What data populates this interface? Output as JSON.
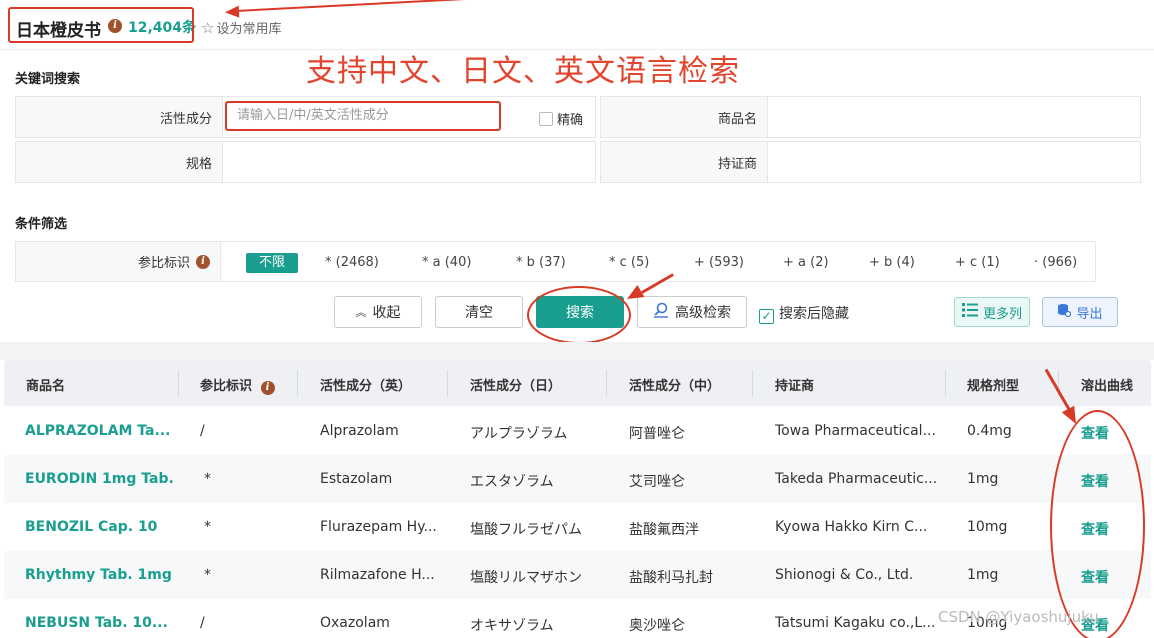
{
  "header": {
    "title": "日本橙皮书",
    "count": "12,404条",
    "favorite_label": "设为常用库"
  },
  "annotation": {
    "text": "支持中文、日文、英文语言检索"
  },
  "keyword_search": {
    "section_title": "关键词搜索",
    "active_ingredient_label": "活性成分",
    "active_ingredient_placeholder": "请输入日/中/英文活性成分",
    "exact_label": "精确",
    "product_name_label": "商品名",
    "spec_label": "规格",
    "holder_label": "持证商"
  },
  "filter": {
    "section_title": "条件筛选",
    "label": "参比标识",
    "options": [
      "不限",
      "* (2468)",
      "* a (40)",
      "* b (37)",
      "* c (5)",
      "+ (593)",
      "+ a (2)",
      "+ b (4)",
      "+ c (1)",
      "· (966)"
    ]
  },
  "actions": {
    "collapse": "收起",
    "clear": "清空",
    "search": "搜索",
    "advanced": "高级检索",
    "hide_after_search": "搜索后隐藏",
    "more_columns": "更多列",
    "export": "导出"
  },
  "table": {
    "headers": [
      "商品名",
      "参比标识",
      "活性成分（英）",
      "活性成分（日）",
      "活性成分（中）",
      "持证商",
      "规格剂型",
      "溶出曲线"
    ],
    "rows": [
      {
        "name": "ALPRAZOLAM Ta...",
        "mark": "/",
        "en": "Alprazolam",
        "jp": "アルプラゾラム",
        "cn": "阿普唑仑",
        "holder": "Towa Pharmaceutical...",
        "spec": "0.4mg",
        "curve": "查看"
      },
      {
        "name": "EURODIN 1mg Tab.",
        "mark": "*",
        "en": "Estazolam",
        "jp": "エスタゾラム",
        "cn": "艾司唑仑",
        "holder": "Takeda Pharmaceutic...",
        "spec": "1mg",
        "curve": "查看"
      },
      {
        "name": "BENOZIL Cap. 10",
        "mark": "*",
        "en": "Flurazepam Hy...",
        "jp": "塩酸フルラゼパム",
        "cn": "盐酸氟西泮",
        "holder": "Kyowa Hakko Kirn C...",
        "spec": "10mg",
        "curve": "查看"
      },
      {
        "name": "Rhythmy Tab. 1mg",
        "mark": "*",
        "en": "Rilmazafone H...",
        "jp": "塩酸リルマザホン",
        "cn": "盐酸利马扎封",
        "holder": "Shionogi & Co., Ltd.",
        "spec": "1mg",
        "curve": "查看"
      },
      {
        "name": "NEBUSN Tab. 10...",
        "mark": "/",
        "en": "Oxazolam",
        "jp": "オキサゾラム",
        "cn": "奥沙唑仑",
        "holder": "Tatsumi Kagaku co.,L...",
        "spec": "10mg",
        "curve": "查看"
      }
    ]
  },
  "watermark": "CSDN @Yiyaoshujuku",
  "colors": {
    "accent": "#1a9e8f",
    "annotation": "#d93a26",
    "info": "#a0522d"
  }
}
